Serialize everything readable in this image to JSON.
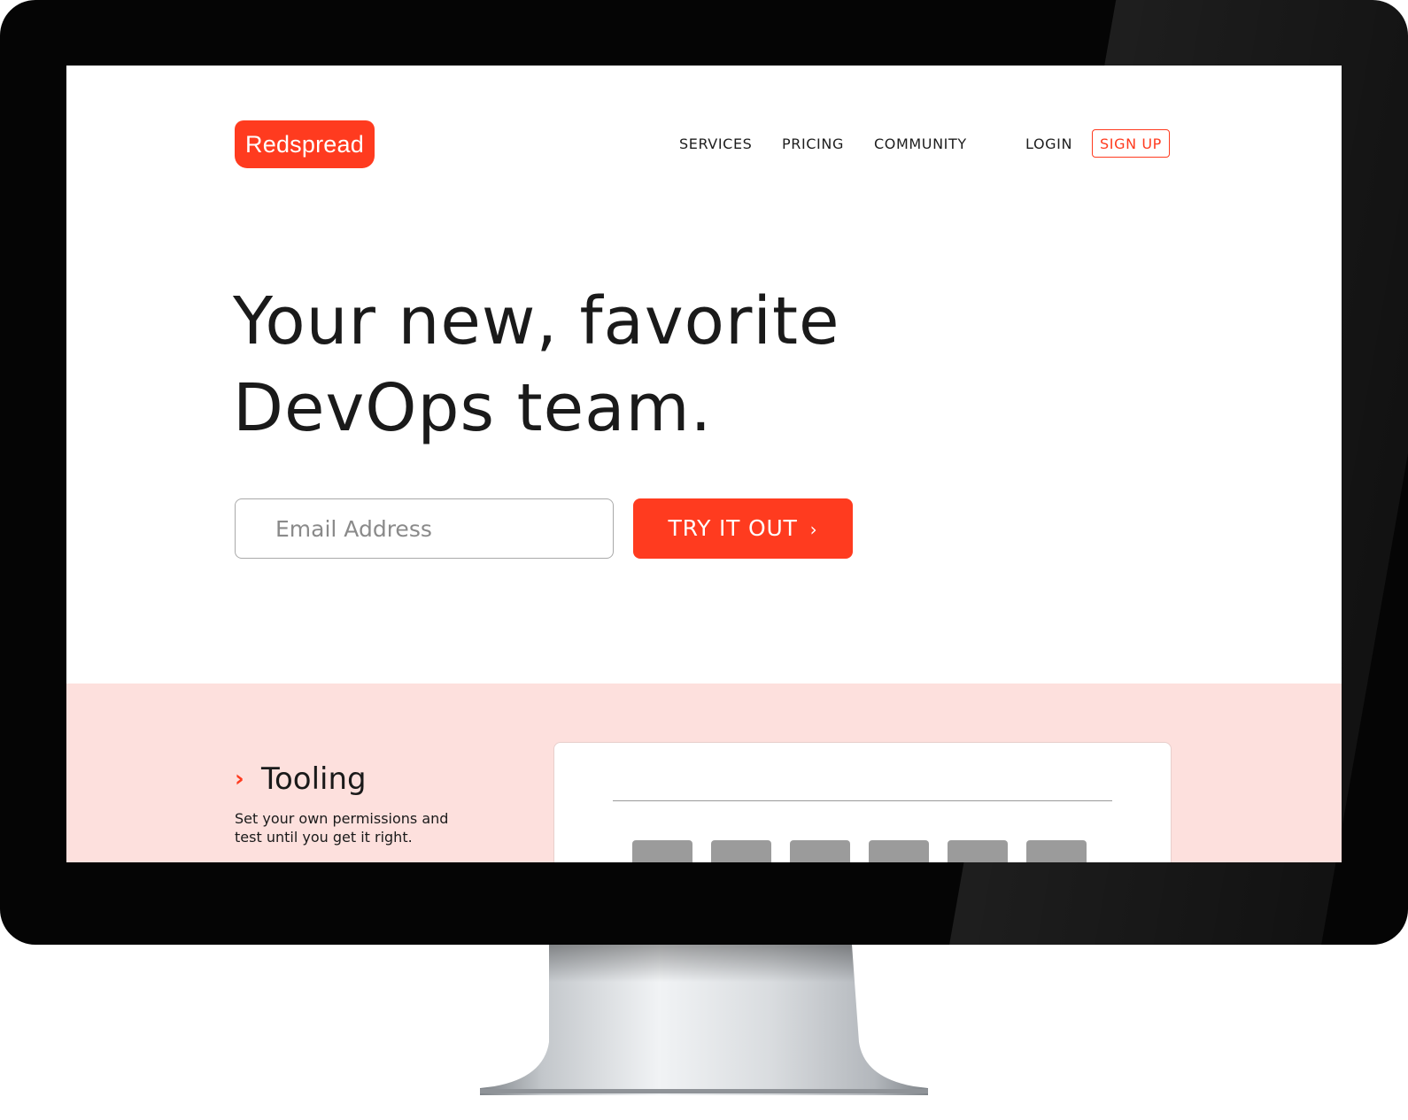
{
  "brand": {
    "logo_text": "Redspread",
    "accent_color": "#ff3b1f"
  },
  "nav": {
    "services": "SERVICES",
    "pricing": "PRICING",
    "community": "COMMUNITY",
    "login": "LOGIN",
    "signup": "SIGN UP"
  },
  "hero": {
    "headline_line1": "Your new, favorite",
    "headline_line2": "DevOps team.",
    "email_placeholder": "Email Address",
    "cta_label": "TRY IT OUT",
    "cta_icon": "chevron-right-icon",
    "cta_glyph": "›"
  },
  "feature": {
    "icon": "chevron-right-icon",
    "icon_glyph": "›",
    "title": "Tooling",
    "description_line1": "Set your own permissions and",
    "description_line2": "test until you get it right.",
    "background_color": "#fde0dd"
  }
}
